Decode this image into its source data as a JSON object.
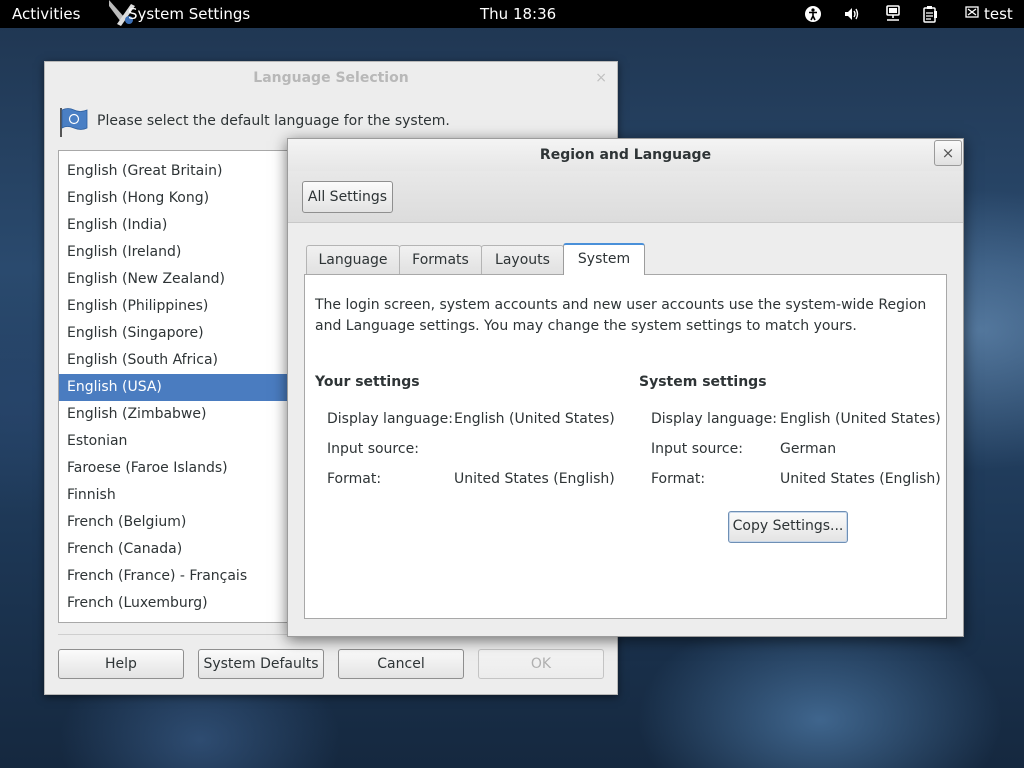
{
  "topbar": {
    "activities": "Activities",
    "app_name": "System Settings",
    "clock": "Thu 18:36",
    "user": "test",
    "icons": [
      "accessibility-icon",
      "volume-icon",
      "network-icon",
      "clipboard-icon",
      "user-icon"
    ]
  },
  "language_dialog": {
    "title": "Language Selection",
    "close": "×",
    "prompt": "Please select the default language for the system.",
    "languages": [
      "English (Great Britain)",
      "English (Hong Kong)",
      "English (India)",
      "English (Ireland)",
      "English (New Zealand)",
      "English (Philippines)",
      "English (Singapore)",
      "English (South Africa)",
      "English (USA)",
      "English (Zimbabwe)",
      "Estonian",
      "Faroese (Faroe Islands)",
      "Finnish",
      "French (Belgium)",
      "French (Canada)",
      "French (France) - Français",
      "French (Luxemburg)"
    ],
    "selected": "English (USA)",
    "buttons": {
      "help": "Help",
      "system_defaults": "System Defaults",
      "cancel": "Cancel",
      "ok": "OK"
    }
  },
  "region_window": {
    "title": "Region and Language",
    "close": "×",
    "all_settings": "All Settings",
    "tabs": [
      "Language",
      "Formats",
      "Layouts",
      "System"
    ],
    "active_tab": "System",
    "description": "The login screen, system accounts and new user accounts use the system-wide Region and Language settings. You may change the system settings to match yours.",
    "your_settings": {
      "heading": "Your settings",
      "display_language_label": "Display language:",
      "display_language": "English (United States)",
      "input_source_label": "Input source:",
      "input_source": "",
      "format_label": "Format:",
      "format": "United States (English)"
    },
    "system_settings": {
      "heading": "System settings",
      "display_language_label": "Display language:",
      "display_language": "English (United States)",
      "input_source_label": "Input source:",
      "input_source": "German",
      "format_label": "Format:",
      "format": "United States (English)"
    },
    "copy_button": "Copy Settings..."
  },
  "colors": {
    "selection": "#4a7cc0",
    "active_tab_accent": "#4a90d9",
    "topbar": "#000000"
  }
}
